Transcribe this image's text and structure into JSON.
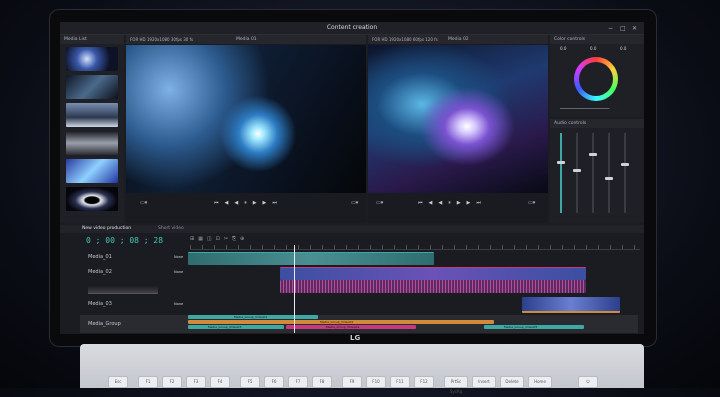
{
  "window": {
    "title": "Content creation",
    "controls": [
      "−",
      "□",
      "✕"
    ]
  },
  "media_list": {
    "title": "Media List"
  },
  "viewer1": {
    "header_left": "FOR HD 1920x1080 30fps  30 fs",
    "title": "Media 01"
  },
  "viewer2": {
    "header_left": "FOR HD 1920x1080 60fps  120 fs",
    "title": "Media 02"
  },
  "color": {
    "title": "Color controls",
    "values": [
      "0.0",
      "0.0",
      "0.0"
    ]
  },
  "audio": {
    "title": "Audio controls"
  },
  "tabs": {
    "active": "New video production",
    "second": "Short video"
  },
  "timecode": "0 ; 00 ; 08 ; 28",
  "tracks": [
    {
      "label": "Media_01",
      "mode": "None"
    },
    {
      "label": "Media_02",
      "mode": "None"
    },
    {
      "label": "Media_03",
      "mode": "None"
    },
    {
      "label": "Media_Group",
      "mode": ""
    }
  ],
  "group_clips": [
    "Media_Group_Video01",
    "Media_Group_Video02",
    "Media_Group_Video03",
    "Media_Group_Video04",
    "Media_Group_Video05"
  ],
  "brand": "LG",
  "keys": [
    "Esc",
    "F1",
    "F2",
    "F3",
    "F4",
    "F5",
    "F6",
    "F7",
    "F8",
    "F9",
    "F10",
    "F11",
    "F12",
    "PrtSc\nSysRq",
    "Insert",
    "Delete",
    "Home",
    "⏻"
  ],
  "colors": {
    "accent": "#3ea8a5",
    "track_teal": "#2f8f8c",
    "track_pink": "#c8387e",
    "track_orange": "#d08a3a"
  }
}
